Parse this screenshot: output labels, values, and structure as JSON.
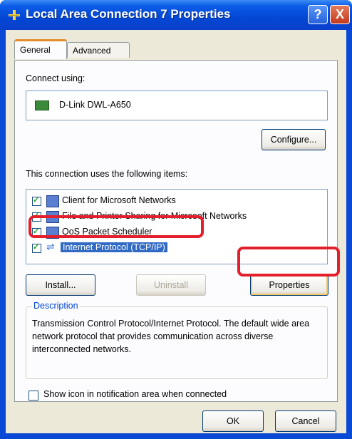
{
  "window": {
    "title": "Local Area Connection 7 Properties",
    "help_label": "?",
    "close_label": "X"
  },
  "tabs": [
    {
      "label": "General",
      "active": true
    },
    {
      "label": "Advanced",
      "active": false
    }
  ],
  "general": {
    "connect_using_label": "Connect using:",
    "adapter_name": "D-Link DWL-A650",
    "configure_label": "Configure...",
    "components_label": "This connection uses the following items:",
    "components": [
      {
        "label": "Client for Microsoft Networks",
        "checked": true
      },
      {
        "label": "File and Printer Sharing for Microsoft Networks",
        "checked": true
      },
      {
        "label": "QoS Packet Scheduler",
        "checked": true
      },
      {
        "label": "Internet Protocol (TCP/IP)",
        "checked": true,
        "selected": true
      }
    ],
    "install_label": "Install...",
    "uninstall_label": "Uninstall",
    "properties_label": "Properties",
    "description_title": "Description",
    "description_text": "Transmission Control Protocol/Internet Protocol. The default wide area network protocol that provides communication across diverse interconnected networks.",
    "show_icon_label": "Show icon in notification area when connected",
    "show_icon_checked": false
  },
  "footer": {
    "ok_label": "OK",
    "cancel_label": "Cancel"
  },
  "colors": {
    "titlebar": "#0347d4",
    "highlight": "#e21f2a",
    "selection": "#316ac5"
  }
}
